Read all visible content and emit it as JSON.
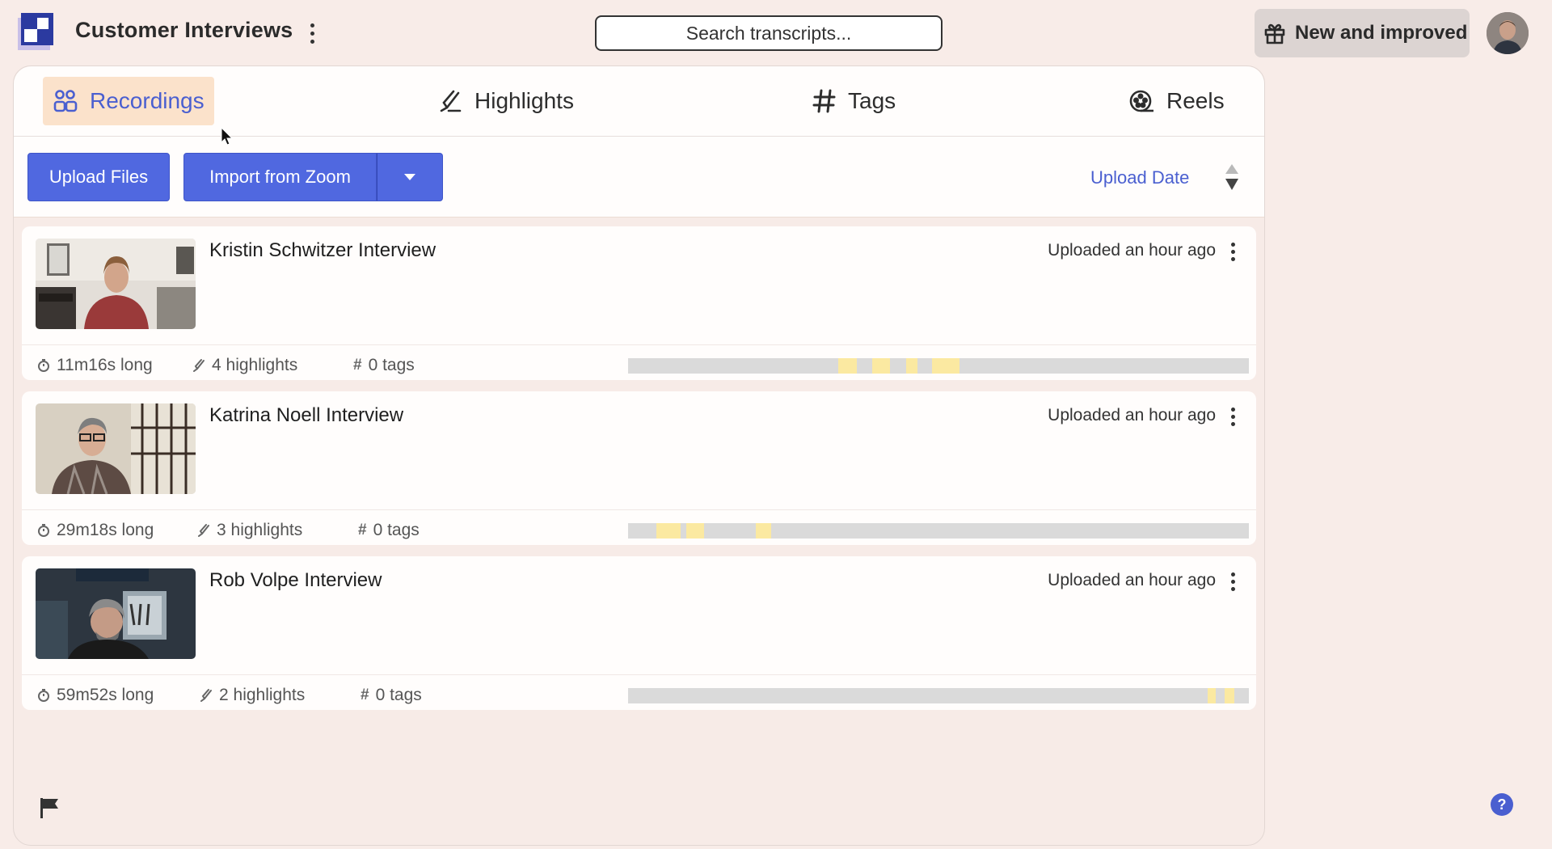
{
  "header": {
    "app_title": "Customer Interviews",
    "search_placeholder": "Search transcripts...",
    "new_button_label": "New and improved"
  },
  "tabs": [
    {
      "label": "Recordings",
      "icon": "people-icon",
      "active": true
    },
    {
      "label": "Highlights",
      "icon": "highlighter-icon",
      "active": false
    },
    {
      "label": "Tags",
      "icon": "hash-icon",
      "active": false
    },
    {
      "label": "Reels",
      "icon": "film-reel-icon",
      "active": false
    }
  ],
  "toolbar": {
    "upload_label": "Upload Files",
    "import_label": "Import from Zoom",
    "sort_label": "Upload Date"
  },
  "recordings": [
    {
      "title": "Kristin Schwitzer Interview",
      "uploaded": "Uploaded an hour ago",
      "duration": "11m16s long",
      "highlights": "4 highlights",
      "tags": "0 tags",
      "highlight_ranges": [
        [
          0.338,
          0.368
        ],
        [
          0.393,
          0.422
        ],
        [
          0.448,
          0.466
        ],
        [
          0.489,
          0.534
        ]
      ]
    },
    {
      "title": "Katrina Noell Interview",
      "uploaded": "Uploaded an hour ago",
      "duration": "29m18s long",
      "highlights": "3 highlights",
      "tags": "0 tags",
      "highlight_ranges": [
        [
          0.045,
          0.085
        ],
        [
          0.094,
          0.123
        ],
        [
          0.206,
          0.231
        ]
      ]
    },
    {
      "title": "Rob Volpe Interview",
      "uploaded": "Uploaded an hour ago",
      "duration": "59m52s long",
      "highlights": "2 highlights",
      "tags": "0 tags",
      "highlight_ranges": [
        [
          0.933,
          0.947
        ],
        [
          0.961,
          0.976
        ]
      ]
    }
  ],
  "colors": {
    "accent": "#5068e0",
    "active_tab_bg": "#fbe2cb",
    "highlight_segment": "#fbe9a1",
    "track": "#dadada",
    "page_bg": "#f8ece8"
  }
}
